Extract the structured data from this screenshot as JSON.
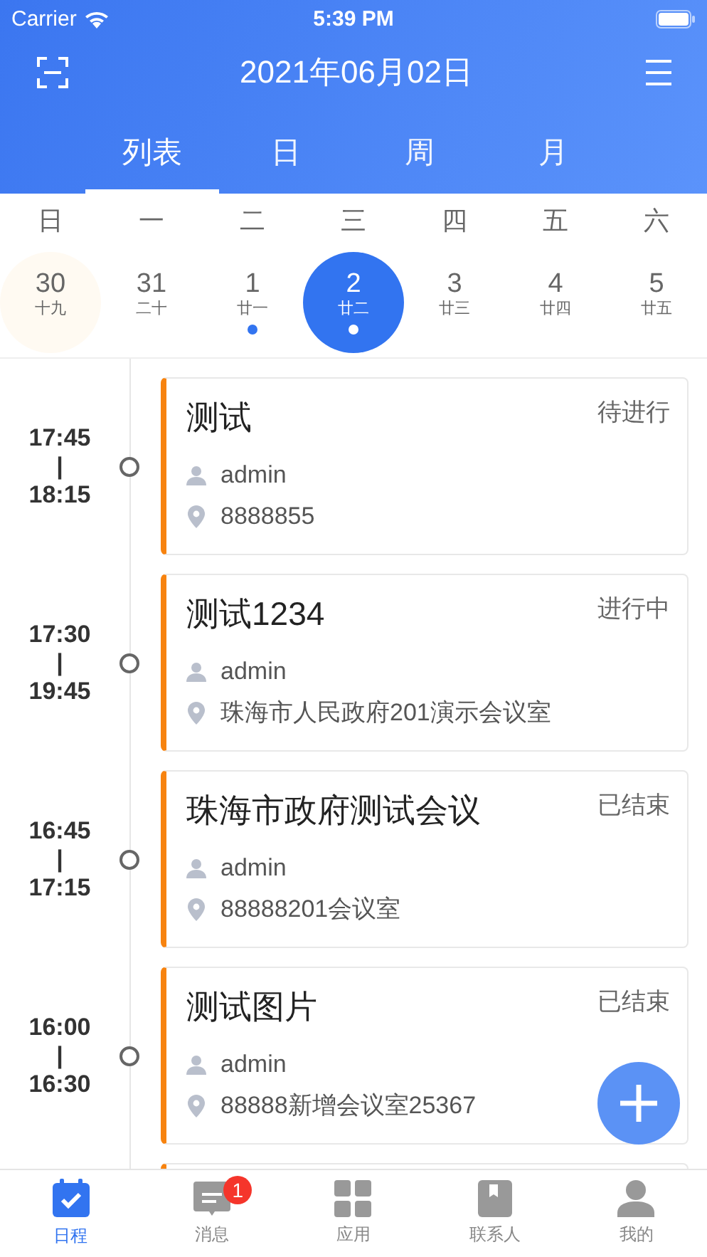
{
  "status_bar": {
    "carrier": "Carrier",
    "time": "5:39 PM"
  },
  "header": {
    "title": "2021年06月02日"
  },
  "tabs": [
    {
      "label": "列表",
      "selected": true
    },
    {
      "label": "日",
      "selected": false
    },
    {
      "label": "周",
      "selected": false
    },
    {
      "label": "月",
      "selected": false
    }
  ],
  "weekdays": [
    "日",
    "一",
    "二",
    "三",
    "四",
    "五",
    "六"
  ],
  "dates": [
    {
      "day": "30",
      "lunar": "十九",
      "selected": false,
      "today": true,
      "has_event": false
    },
    {
      "day": "31",
      "lunar": "二十",
      "selected": false,
      "today": false,
      "has_event": false
    },
    {
      "day": "1",
      "lunar": "廿一",
      "selected": false,
      "today": false,
      "has_event": true
    },
    {
      "day": "2",
      "lunar": "廿二",
      "selected": true,
      "today": false,
      "has_event": true
    },
    {
      "day": "3",
      "lunar": "廿三",
      "selected": false,
      "today": false,
      "has_event": false
    },
    {
      "day": "4",
      "lunar": "廿四",
      "selected": false,
      "today": false,
      "has_event": false
    },
    {
      "day": "5",
      "lunar": "廿五",
      "selected": false,
      "today": false,
      "has_event": false
    }
  ],
  "events": [
    {
      "start": "17:45",
      "separator": "|",
      "end": "18:15",
      "title": "测试",
      "status": "待进行",
      "organizer": "admin",
      "location": "8888855"
    },
    {
      "start": "17:30",
      "separator": "|",
      "end": "19:45",
      "title": "测试1234",
      "status": "进行中",
      "organizer": "admin",
      "location": "珠海市人民政府201演示会议室"
    },
    {
      "start": "16:45",
      "separator": "|",
      "end": "17:15",
      "title": "珠海市政府测试会议",
      "status": "已结束",
      "organizer": "admin",
      "location": "88888201会议室"
    },
    {
      "start": "16:00",
      "separator": "|",
      "end": "16:30",
      "title": "测试图片",
      "status": "已结束",
      "organizer": "admin",
      "location": "88888新增会议室25367"
    }
  ],
  "bottom_nav": [
    {
      "label": "日程",
      "selected": true
    },
    {
      "label": "消息",
      "selected": false,
      "badge": "1"
    },
    {
      "label": "应用",
      "selected": false
    },
    {
      "label": "联系人",
      "selected": false
    },
    {
      "label": "我的",
      "selected": false
    }
  ]
}
